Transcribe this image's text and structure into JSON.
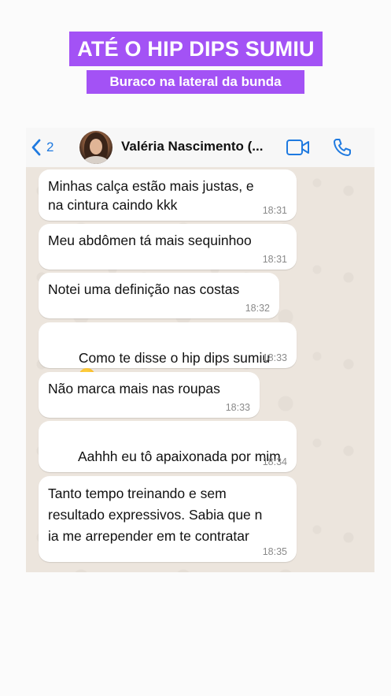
{
  "banner": {
    "title": "ATÉ O HIP DIPS SUMIU",
    "subtitle": "Buraco na lateral da bunda"
  },
  "chat_header": {
    "back_count": "2",
    "contact_name": "Valéria Nascimento (...",
    "icons": {
      "back": "chevron-left-icon",
      "video": "video-camera-icon",
      "call": "phone-icon"
    },
    "accent_color": "#1f7ae0"
  },
  "colors": {
    "banner": "#a352f5",
    "chat_background": "#ece5dd",
    "bubble": "#ffffff"
  },
  "messages": [
    {
      "text": "Minhas calça estão mais justas, e\nna cintura caindo kkk",
      "time": "18:31"
    },
    {
      "text": "Meu abdômen tá mais sequinhoo",
      "time": "18:31"
    },
    {
      "text": "Notei uma definição nas costas",
      "time": "18:32"
    },
    {
      "text": "Como te disse o hip dips sumiu",
      "time": "18:33",
      "emoji": "heart-eyes-emoji"
    },
    {
      "text": "Não marca mais nas roupas",
      "time": "18:33"
    },
    {
      "text": "Aahhh eu tô apaixonada por mim",
      "time": "18:34",
      "emoji": "heart-eyes-emoji-x3"
    },
    {
      "text": "Tanto tempo treinando e sem\nresultado expressivos. Sabia que n\nia me arrepender em te contratar",
      "time": "18:35"
    }
  ]
}
